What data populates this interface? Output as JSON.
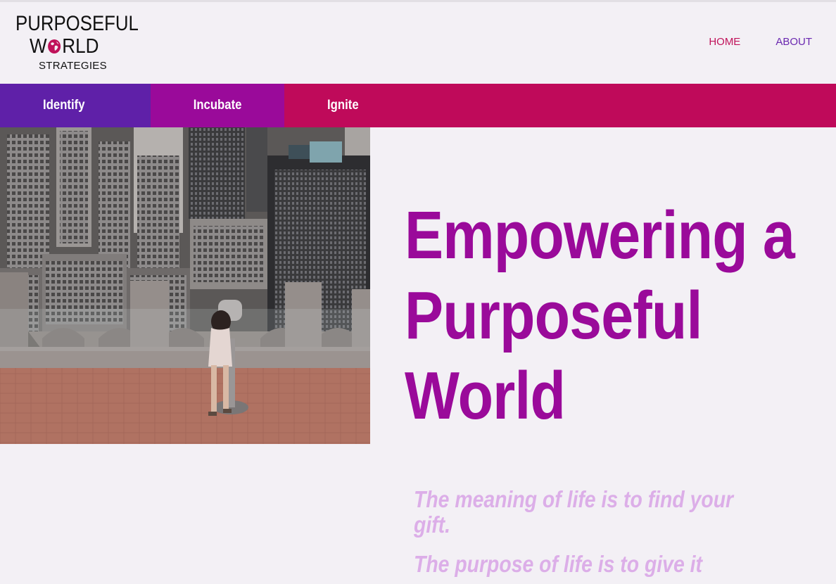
{
  "header": {
    "logo": {
      "line1": "PURPOSEFUL",
      "line2_prefix": "W",
      "line2_suffix": "RLD",
      "line3": "STRATEGIES"
    },
    "nav": [
      {
        "label": "HOME",
        "color": "#c0125a"
      },
      {
        "label": "ABOUT",
        "color": "#6a28b0"
      }
    ]
  },
  "tabs": [
    {
      "label": "Identify",
      "color": "#5f20a8"
    },
    {
      "label": "Incubate",
      "color": "#9a0a9a"
    },
    {
      "label": "Ignite",
      "color": "#bf0a5a"
    }
  ],
  "hero": {
    "headline": [
      "Empowering a",
      "Purposeful",
      "World"
    ],
    "quotes": [
      "The meaning of life is to find your gift.",
      "The purpose of life is to give it"
    ]
  },
  "colors": {
    "background": "#f3f0f5",
    "headline": "#9a0a9a",
    "quote": "#dcaee8"
  }
}
